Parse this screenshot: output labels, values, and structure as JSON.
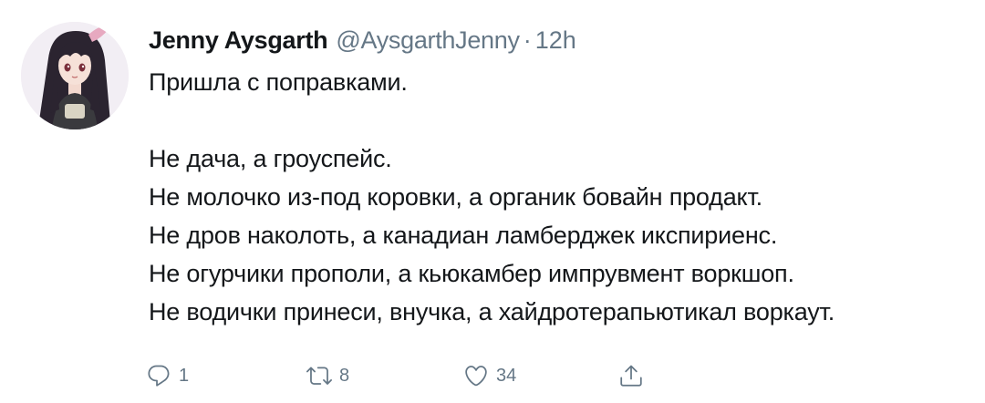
{
  "tweet": {
    "author_name": "Jenny Aysgarth",
    "author_handle": "@AysgarthJenny",
    "separator": "·",
    "time": "12h",
    "lines": [
      "Пришла с поправками.",
      "",
      "Не дача, а гроуспейс.",
      "Не молочко из-под коровки, а органик бовайн продакт.",
      "Не дров наколоть, а канадиан ламберджек икспириенс.",
      "Не огурчики прополи, а кьюкамбер импрувмент воркшоп.",
      "Не водички принеси, внучка, а хайдротерапьютикал воркаут."
    ]
  },
  "actions": {
    "reply": {
      "icon": "reply-icon",
      "count": "1"
    },
    "retweet": {
      "icon": "retweet-icon",
      "count": "8"
    },
    "like": {
      "icon": "heart-icon",
      "count": "34"
    },
    "share": {
      "icon": "share-icon"
    }
  },
  "colors": {
    "text": "#14171a",
    "secondary": "#657786",
    "background": "#ffffff"
  }
}
